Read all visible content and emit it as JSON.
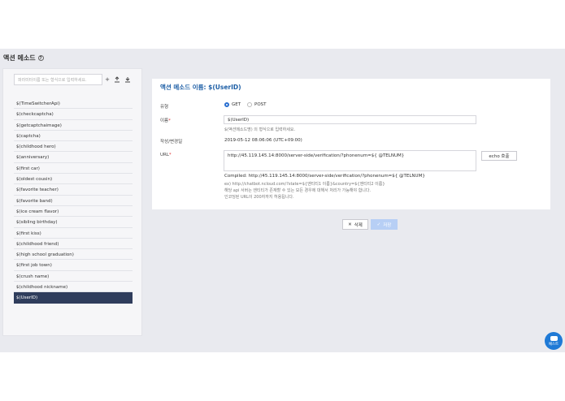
{
  "page": {
    "title": "액션 메소드",
    "help_icon": "?"
  },
  "sidebar": {
    "search_placeholder": "파라미터이름 또는 형식으로 입력하세요.",
    "upload_icon": "⭳",
    "download_icon": "⭳",
    "items": [
      "$(TimeSwitcherApi)",
      "$(checkcaptcha)",
      "$(getcaptchaimage)",
      "$(captcha)",
      "$(childhood hero)",
      "$(anniversary)",
      "$(first car)",
      "$(oldest cousin)",
      "$(favorite teacher)",
      "$(favorite band)",
      "$(ice cream flavor)",
      "$(sibling birthday)",
      "$(first kiss)",
      "$(childhood friend)",
      "$(high school graduation)",
      "$(first job town)",
      "$(crush name)",
      "$(childhood nickname)",
      "$(UserID)"
    ],
    "selected_index": 18
  },
  "detail": {
    "title": "액션 메소드 이름: $(UserID)",
    "type_label": "유형",
    "get_label": "GET",
    "post_label": "POST",
    "selected_type": "GET",
    "name_label": "이름",
    "required_mark": "*",
    "name_value": "$(UserID)",
    "name_hint": "$(액션메소드명) 의 형식으로 입력하세요.",
    "date_label": "작성/변경일",
    "date_value": "2019-05-12 08:06:06 (UTC+09:00)",
    "url_label": "URL",
    "url_value": "http://45.119.145.14:8000/server-side/verification/?phonenum=${ @TELNUM}",
    "echo_label": "echo 호출",
    "compiled": "Compiled: http://45.119.145.14:8000/server-side/verification/?phonenum=${ @TELNUM}",
    "hint_lines": [
      "ex) http://chatbot.ncloud.com/?state=${엔티티1 이름}&country=${엔티티2 이름}",
      "해당 api 서버는 엔티티가 존재할 수 있는 모든 경우에 대해서 처리가 가능해야 합니다.",
      "인코딩된 URL이 200자까지 허용됩니다."
    ]
  },
  "actions": {
    "delete_label": "삭제",
    "save_label": "저장"
  },
  "chat": {
    "label": "채스트"
  },
  "colors": {
    "accent": "#1e5fa6",
    "selected_bg": "#2f3d5c",
    "save_disabled": "#b7cff5",
    "chat": "#1f7ad6"
  }
}
